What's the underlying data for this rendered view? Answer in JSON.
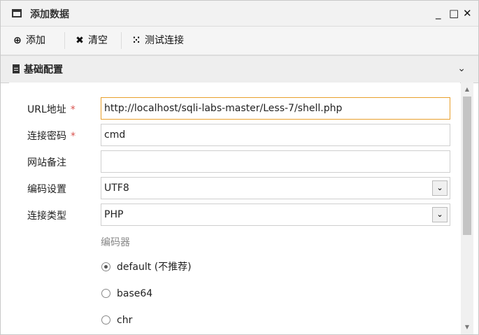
{
  "window": {
    "title": "添加数据",
    "minimize": "_",
    "maximize": "□",
    "close": "✕"
  },
  "toolbar": {
    "add_label": "添加",
    "clear_label": "清空",
    "test_label": "测试连接"
  },
  "panel": {
    "title": "基础配置"
  },
  "form": {
    "url_label": "URL地址",
    "url_required": "*",
    "url_value": "http://localhost/sqli-labs-master/Less-7/shell.php",
    "password_label": "连接密码",
    "password_required": "*",
    "password_value": "cmd",
    "note_label": "网站备注",
    "note_value": "",
    "encoding_label": "编码设置",
    "encoding_value": "UTF8",
    "type_label": "连接类型",
    "type_value": "PHP",
    "encoder_label": "编码器",
    "encoders": [
      {
        "label": "default (不推荐)",
        "checked": true
      },
      {
        "label": "base64",
        "checked": false
      },
      {
        "label": "chr",
        "checked": false
      }
    ]
  }
}
